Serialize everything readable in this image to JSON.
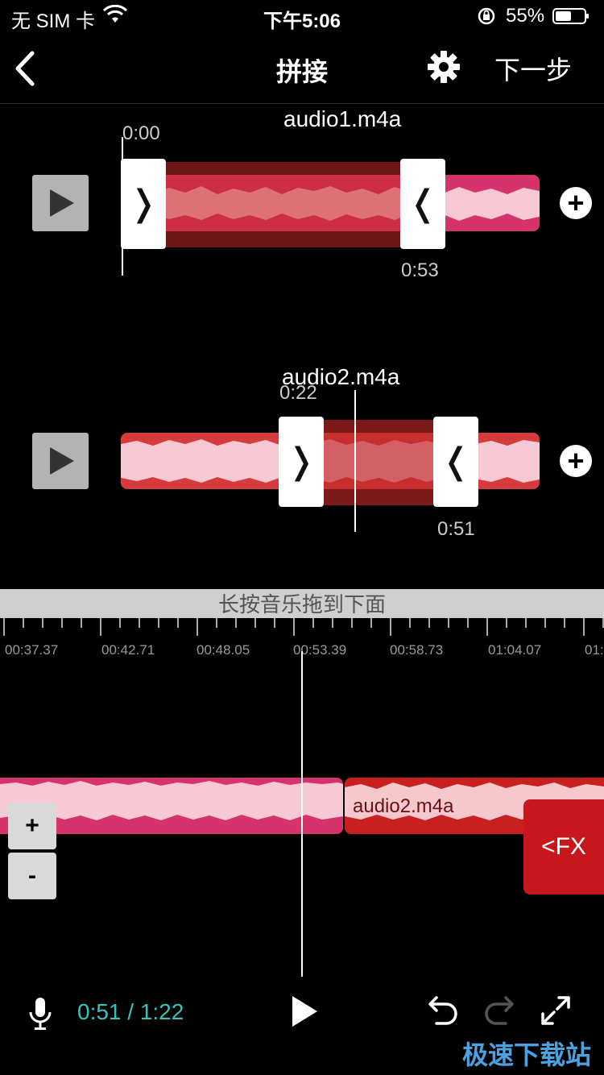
{
  "status": {
    "carrier": "无 SIM 卡",
    "time": "下午5:06",
    "battery_pct": "55%",
    "battery_level": 0.55
  },
  "nav": {
    "title": "拼接",
    "next": "下一步",
    "back_icon": "chevron-left-icon",
    "settings_icon": "gear-icon"
  },
  "track1": {
    "filename": "audio1.m4a",
    "start_label": "0:00",
    "end_label": "0:53",
    "handle_left": "❭",
    "handle_right": "❬"
  },
  "track2": {
    "filename": "audio2.m4a",
    "start_label": "0:22",
    "end_label": "0:51",
    "handle_left": "❭",
    "handle_right": "❬"
  },
  "hint": "长按音乐拖到下面",
  "ruler": {
    "labels": [
      "00:37.37",
      "00:42.71",
      "00:48.05",
      "00:53.39",
      "00:58.73",
      "01:04.07",
      "01:"
    ]
  },
  "timeline": {
    "clip2_label": "audio2.m4a",
    "zoom_in": "+",
    "zoom_out": "-",
    "fx_label": "<FX"
  },
  "transport": {
    "time": "0:51 / 1:22"
  },
  "watermark": "极速下载站",
  "colors": {
    "accent_teal": "#35c3c0",
    "clip_pink": "#d6336c",
    "clip_red": "#d63a3a",
    "fx_red": "#c8161d"
  }
}
